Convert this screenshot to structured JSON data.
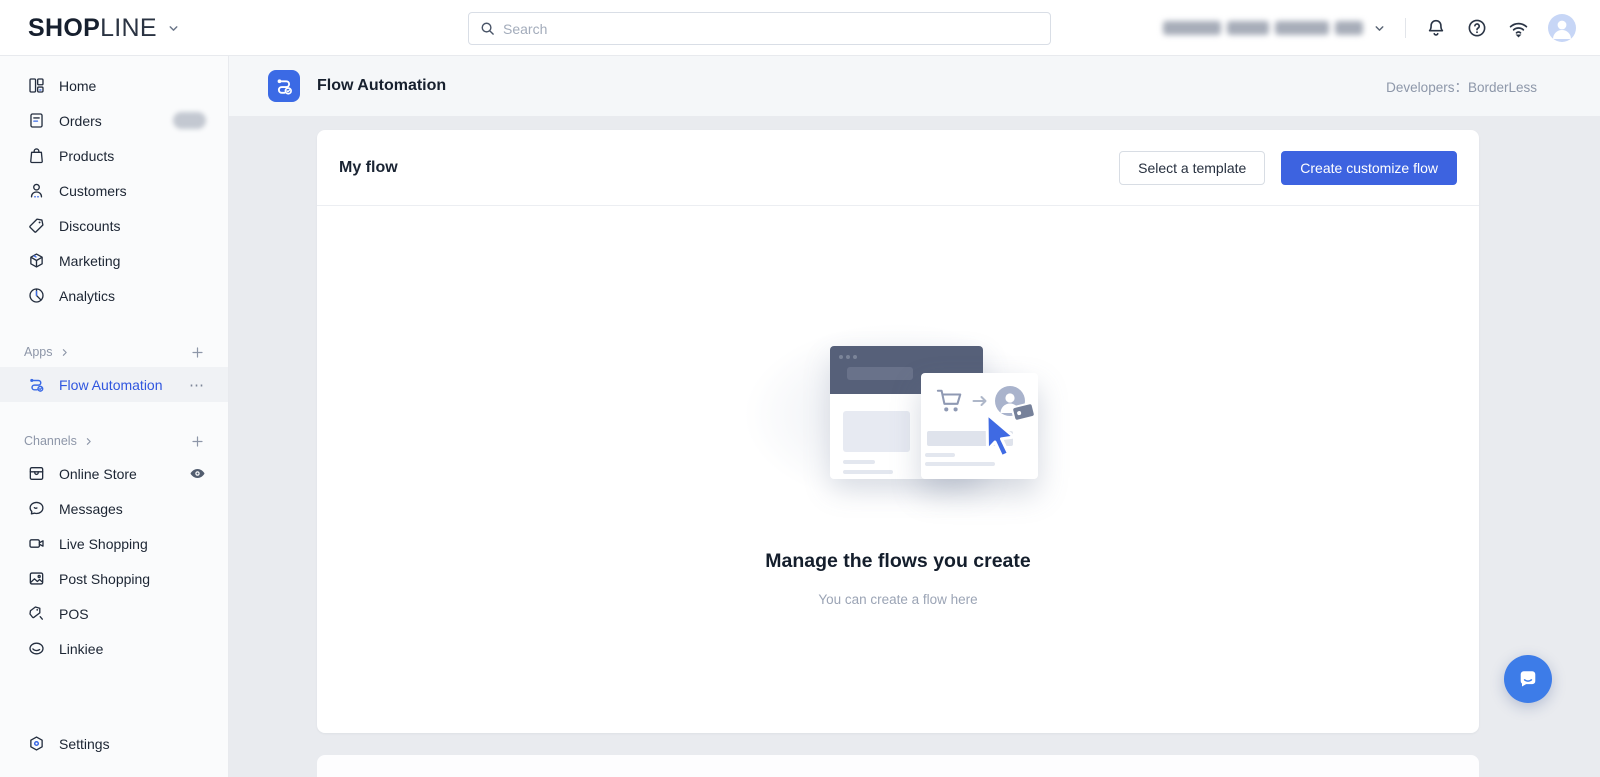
{
  "topbar": {
    "logo_bold": "SHOP",
    "logo_light": "LINE",
    "search_placeholder": "Search"
  },
  "sidebar": {
    "items": [
      {
        "label": "Home"
      },
      {
        "label": "Orders"
      },
      {
        "label": "Products"
      },
      {
        "label": "Customers"
      },
      {
        "label": "Discounts"
      },
      {
        "label": "Marketing"
      },
      {
        "label": "Analytics"
      }
    ],
    "apps_section": {
      "label": "Apps",
      "active_item": {
        "label": "Flow Automation"
      },
      "more_glyph": "⋯"
    },
    "channels_section": {
      "label": "Channels",
      "items": [
        {
          "label": "Online Store"
        },
        {
          "label": "Messages"
        },
        {
          "label": "Live Shopping"
        },
        {
          "label": "Post Shopping"
        },
        {
          "label": "POS"
        },
        {
          "label": "Linkiee"
        }
      ]
    },
    "settings_label": "Settings"
  },
  "page_header": {
    "title": "Flow Automation",
    "breadcrumb": "Developers：BorderLess"
  },
  "my_flow": {
    "title": "My flow",
    "select_template_button": "Select a template",
    "create_flow_button": "Create customize flow",
    "empty_title": "Manage the flows you create",
    "empty_subtitle": "You can create a flow here"
  },
  "colors": {
    "accent_blue": "#3d63e0",
    "app_icon_blue": "#3b6ae5",
    "selected_text_blue": "#3056df",
    "chat_bubble_blue": "#3d7ce8",
    "illustration_slate": "#566079"
  }
}
